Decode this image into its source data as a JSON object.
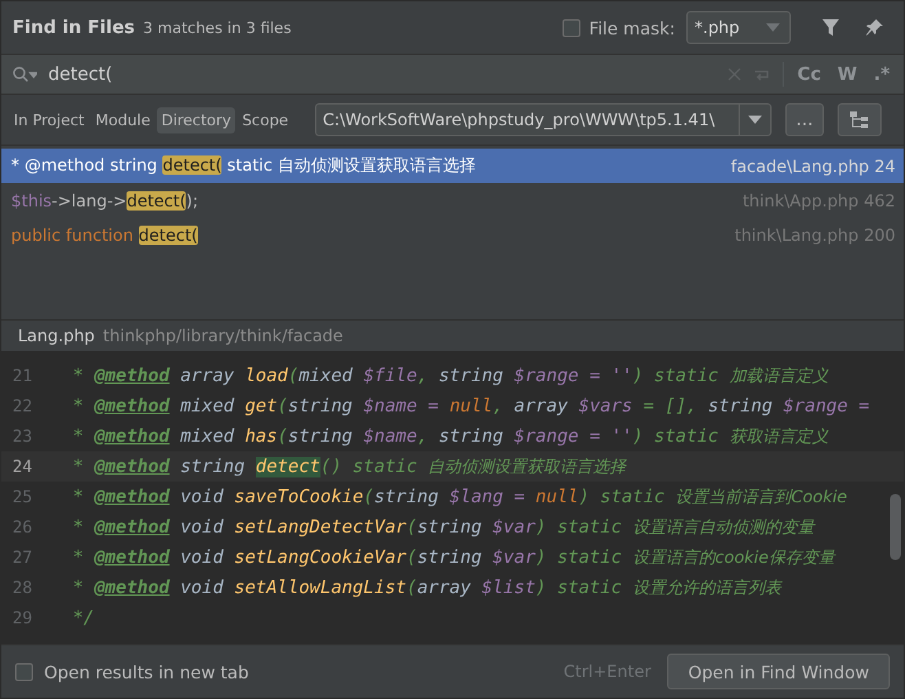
{
  "header": {
    "title": "Find in Files",
    "summary": "3 matches in 3 files",
    "file_mask": {
      "label": "File mask:",
      "checked": false,
      "value": "*.php"
    }
  },
  "search": {
    "value": "detect(",
    "toggles": [
      {
        "label": "Cc",
        "on": false
      },
      {
        "label": "W",
        "on": false
      },
      {
        "label": ".*",
        "on": false
      }
    ]
  },
  "scopes": [
    {
      "label": "In Project",
      "selected": false
    },
    {
      "label": "Module",
      "selected": false
    },
    {
      "label": "Directory",
      "selected": true
    },
    {
      "label": "Scope",
      "selected": false
    }
  ],
  "directory": {
    "value": "C:\\WorkSoftWare\\phpstudy_pro\\WWW\\tp5.1.41\\",
    "browse": "..."
  },
  "results": [
    {
      "selected": true,
      "location": "facade\\Lang.php 24",
      "parts": [
        {
          "kind": "plain",
          "text": "* @method string "
        },
        {
          "kind": "match",
          "text": "detect("
        },
        {
          "kind": "plain",
          "text": " static 自动侦测设置获取语言选择"
        }
      ]
    },
    {
      "selected": false,
      "location": "think\\App.php 462",
      "parts": [
        {
          "kind": "var",
          "text": "$this"
        },
        {
          "kind": "plain",
          "text": "->lang->"
        },
        {
          "kind": "match",
          "text": "detect("
        },
        {
          "kind": "plain",
          "text": ");"
        }
      ]
    },
    {
      "selected": false,
      "location": "think\\Lang.php 200",
      "parts": [
        {
          "kind": "keyword",
          "text": "public function "
        },
        {
          "kind": "match",
          "text": "detect("
        }
      ]
    }
  ],
  "preview": {
    "file": "Lang.php",
    "path": "thinkphp/library/think/facade",
    "lines": [
      {
        "number": "21",
        "current": false,
        "tokens": [
          {
            "kind": "doc",
            "text": " * "
          },
          {
            "kind": "tag",
            "text": "@method"
          },
          {
            "kind": "type",
            "text": " array "
          },
          {
            "kind": "fn",
            "text": "load"
          },
          {
            "kind": "doc",
            "text": "("
          },
          {
            "kind": "type",
            "text": "mixed "
          },
          {
            "kind": "var",
            "text": "$file"
          },
          {
            "kind": "doc",
            "text": ", "
          },
          {
            "kind": "type",
            "text": "string "
          },
          {
            "kind": "var",
            "text": "$range = ''"
          },
          {
            "kind": "doc",
            "text": ") static "
          },
          {
            "kind": "comment",
            "text": "加载语言定义"
          }
        ]
      },
      {
        "number": "22",
        "current": false,
        "tokens": [
          {
            "kind": "doc",
            "text": " * "
          },
          {
            "kind": "tag",
            "text": "@method"
          },
          {
            "kind": "type",
            "text": " mixed "
          },
          {
            "kind": "fn",
            "text": "get"
          },
          {
            "kind": "doc",
            "text": "("
          },
          {
            "kind": "type",
            "text": "string "
          },
          {
            "kind": "var",
            "text": "$name"
          },
          {
            "kind": "var",
            "text": " = "
          },
          {
            "kind": "null",
            "text": "null"
          },
          {
            "kind": "doc",
            "text": ", "
          },
          {
            "kind": "type",
            "text": "array "
          },
          {
            "kind": "var",
            "text": "$vars"
          },
          {
            "kind": "doc",
            "text": " = [], "
          },
          {
            "kind": "type",
            "text": "string "
          },
          {
            "kind": "var",
            "text": "$range ="
          }
        ]
      },
      {
        "number": "23",
        "current": false,
        "tokens": [
          {
            "kind": "doc",
            "text": " * "
          },
          {
            "kind": "tag",
            "text": "@method"
          },
          {
            "kind": "type",
            "text": " mixed "
          },
          {
            "kind": "fn",
            "text": "has"
          },
          {
            "kind": "doc",
            "text": "("
          },
          {
            "kind": "type",
            "text": "string "
          },
          {
            "kind": "var",
            "text": "$name"
          },
          {
            "kind": "doc",
            "text": ", "
          },
          {
            "kind": "type",
            "text": "string "
          },
          {
            "kind": "var",
            "text": "$range = ''"
          },
          {
            "kind": "doc",
            "text": ") static "
          },
          {
            "kind": "comment",
            "text": "获取语言定义"
          }
        ]
      },
      {
        "number": "24",
        "current": true,
        "tokens": [
          {
            "kind": "doc",
            "text": " * "
          },
          {
            "kind": "tag",
            "text": "@method"
          },
          {
            "kind": "type",
            "text": " string "
          },
          {
            "kind": "match",
            "text": "detect"
          },
          {
            "kind": "doc",
            "text": "() static "
          },
          {
            "kind": "comment",
            "text": "自动侦测设置获取语言选择"
          }
        ]
      },
      {
        "number": "25",
        "current": false,
        "tokens": [
          {
            "kind": "doc",
            "text": " * "
          },
          {
            "kind": "tag",
            "text": "@method"
          },
          {
            "kind": "type",
            "text": " void "
          },
          {
            "kind": "fn",
            "text": "saveToCookie"
          },
          {
            "kind": "doc",
            "text": "("
          },
          {
            "kind": "type",
            "text": "string "
          },
          {
            "kind": "var",
            "text": "$lang"
          },
          {
            "kind": "var",
            "text": " = "
          },
          {
            "kind": "null",
            "text": "null"
          },
          {
            "kind": "doc",
            "text": ") static "
          },
          {
            "kind": "comment",
            "text": "设置当前语言到Cookie"
          }
        ]
      },
      {
        "number": "26",
        "current": false,
        "tokens": [
          {
            "kind": "doc",
            "text": " * "
          },
          {
            "kind": "tag",
            "text": "@method"
          },
          {
            "kind": "type",
            "text": " void "
          },
          {
            "kind": "fn",
            "text": "setLangDetectVar"
          },
          {
            "kind": "doc",
            "text": "("
          },
          {
            "kind": "type",
            "text": "string "
          },
          {
            "kind": "var",
            "text": "$var"
          },
          {
            "kind": "doc",
            "text": ") static "
          },
          {
            "kind": "comment",
            "text": "设置语言自动侦测的变量"
          }
        ]
      },
      {
        "number": "27",
        "current": false,
        "tokens": [
          {
            "kind": "doc",
            "text": " * "
          },
          {
            "kind": "tag",
            "text": "@method"
          },
          {
            "kind": "type",
            "text": " void "
          },
          {
            "kind": "fn",
            "text": "setLangCookieVar"
          },
          {
            "kind": "doc",
            "text": "("
          },
          {
            "kind": "type",
            "text": "string "
          },
          {
            "kind": "var",
            "text": "$var"
          },
          {
            "kind": "doc",
            "text": ") static "
          },
          {
            "kind": "comment",
            "text": "设置语言的cookie保存变量"
          }
        ]
      },
      {
        "number": "28",
        "current": false,
        "tokens": [
          {
            "kind": "doc",
            "text": " * "
          },
          {
            "kind": "tag",
            "text": "@method"
          },
          {
            "kind": "type",
            "text": " void "
          },
          {
            "kind": "fn",
            "text": "setAllowLangList"
          },
          {
            "kind": "doc",
            "text": "("
          },
          {
            "kind": "type",
            "text": "array "
          },
          {
            "kind": "var",
            "text": "$list"
          },
          {
            "kind": "doc",
            "text": ") static "
          },
          {
            "kind": "comment",
            "text": "设置允许的语言列表"
          }
        ]
      },
      {
        "number": "29",
        "current": false,
        "tokens": [
          {
            "kind": "doc",
            "text": " */"
          }
        ]
      }
    ]
  },
  "footer": {
    "new_tab": {
      "label": "Open results in new tab",
      "checked": false
    },
    "shortcut": "Ctrl+Enter",
    "button": "Open in Find Window"
  }
}
